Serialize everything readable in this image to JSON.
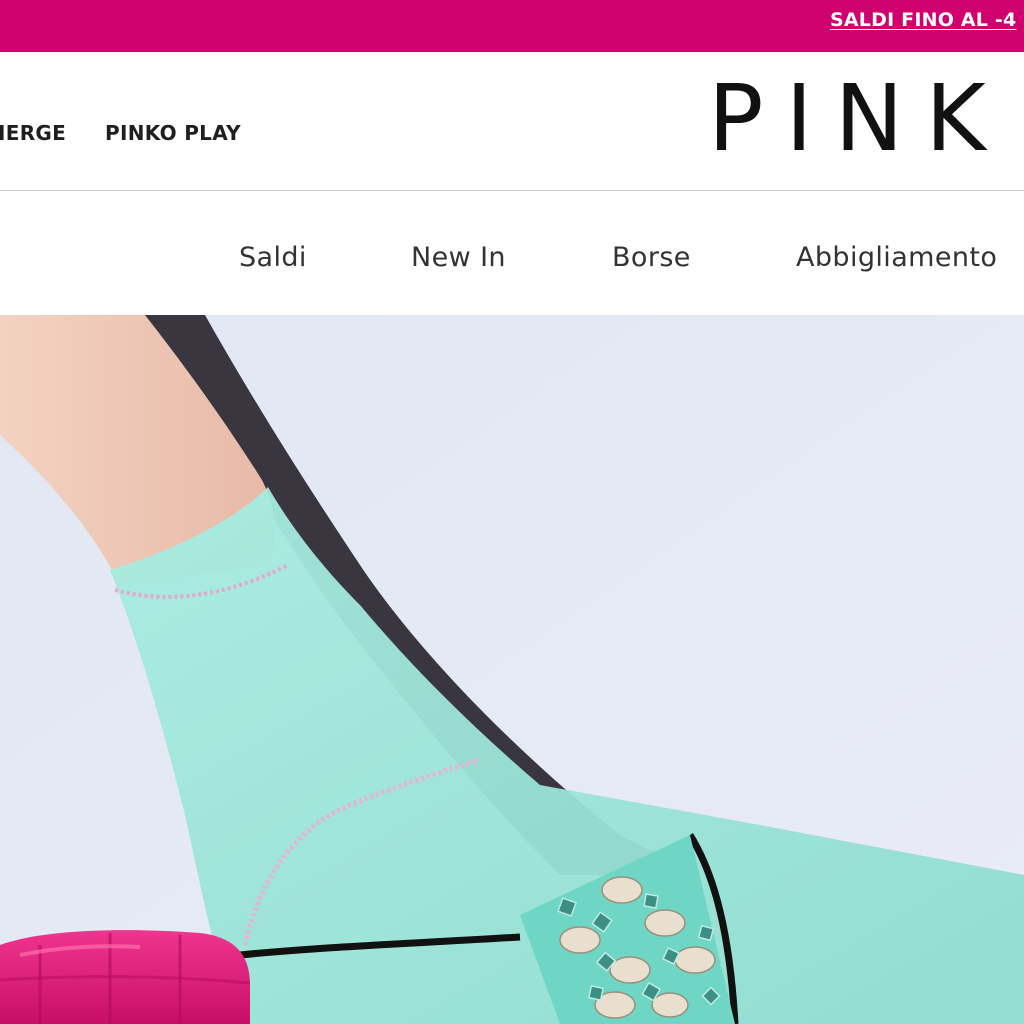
{
  "promo": {
    "text": "SALDI FINO AL -4"
  },
  "header": {
    "utility_links": [
      "IERGE",
      "PINKO PLAY"
    ],
    "logo_text": "PINK"
  },
  "nav": {
    "items": [
      "Saldi",
      "New In",
      "Borse",
      "Abbigliamento"
    ]
  },
  "hero": {
    "image_name": "hero-campaign-image"
  },
  "colors": {
    "promo_background": "#d1006f",
    "promo_text": "#ffffff",
    "text_dark": "#1f1f1f",
    "hero_background": "#e3e8f3",
    "sock_mint": "#9fe8dc",
    "bag_pink": "#e2197d"
  }
}
